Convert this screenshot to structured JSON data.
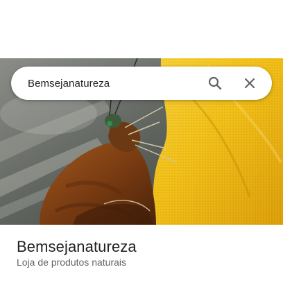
{
  "search": {
    "value": "Bemsejanatureza",
    "search_icon": "search-icon",
    "clear_icon": "close-icon"
  },
  "photo": {
    "subject": "butterfly-on-yellow-fabric-photo"
  },
  "place": {
    "title": "Bemsejanatureza",
    "subtitle": "Loja de produtos naturais"
  },
  "colors": {
    "title_text": "#202124",
    "subtitle_text": "#5f6368",
    "icon": "#5f6368",
    "fabric_yellow": "#f2c11c",
    "wing_brown": "#7a3c12"
  }
}
